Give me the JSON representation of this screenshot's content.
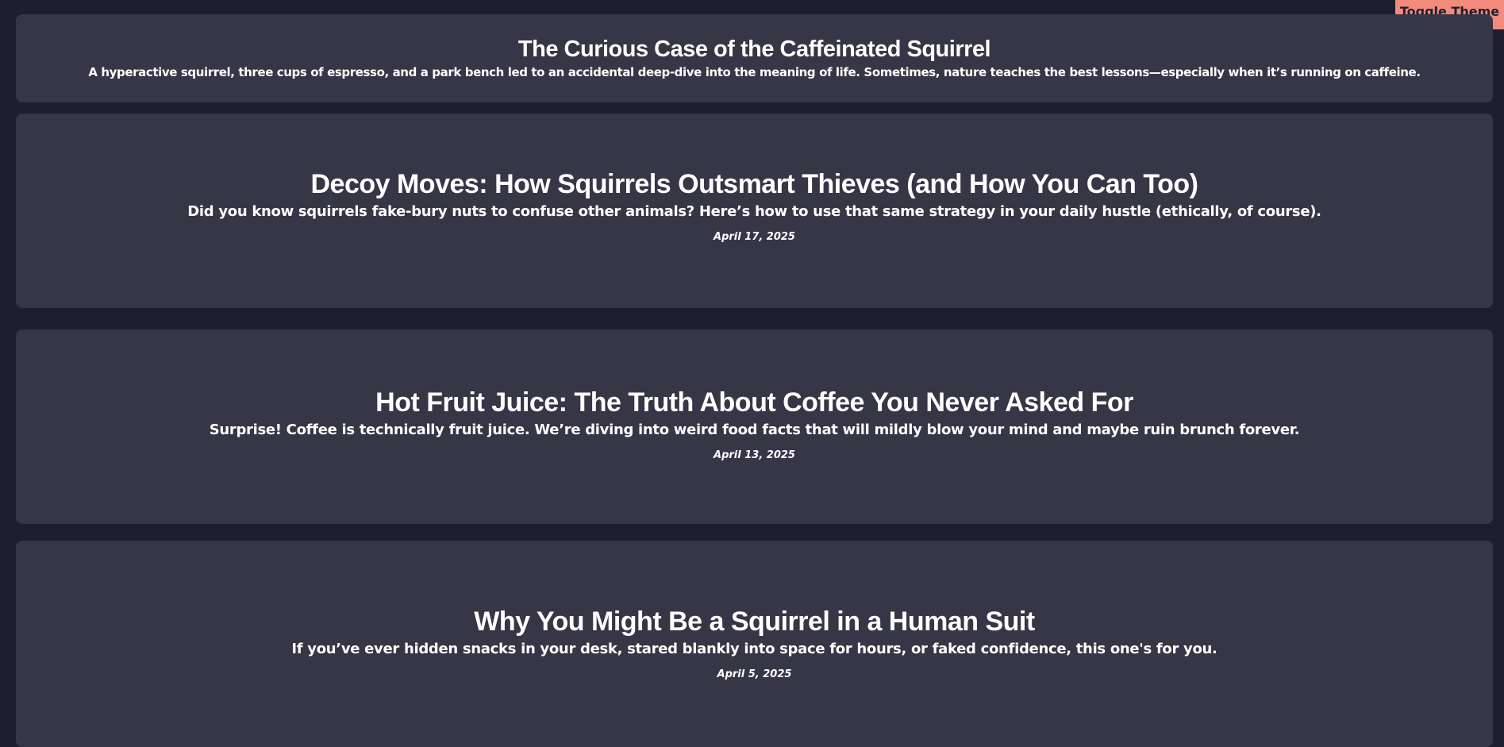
{
  "header": {
    "toggle_theme_label": "Toggle Theme"
  },
  "posts": [
    {
      "title": "The Curious Case of the Caffeinated Squirrel",
      "summary": "A hyperactive squirrel, three cups of espresso, and a park bench led to an accidental deep-dive into the meaning of life. Sometimes, nature teaches the best lessons—especially when it’s running on caffeine."
    },
    {
      "title": "Decoy Moves: How Squirrels Outsmart Thieves (and How You Can Too)",
      "summary": "Did you know squirrels fake-bury nuts to confuse other animals? Here’s how to use that same strategy in your daily hustle (ethically, of course).",
      "date": "April 17, 2025"
    },
    {
      "title": "Hot Fruit Juice: The Truth About Coffee You Never Asked For",
      "summary": "Surprise! Coffee is technically fruit juice. We’re diving into weird food facts that will mildly blow your mind and maybe ruin brunch forever.",
      "date": "April 13, 2025"
    },
    {
      "title": "Why You Might Be a Squirrel in a Human Suit",
      "summary": "If you’ve ever hidden snacks in your desk, stared blankly into space for hours, or faked confidence, this one's for you.",
      "date": "April 5, 2025"
    }
  ],
  "colors": {
    "background": "#1e1e2e",
    "card": "#363646",
    "accent": "#f38b7c",
    "text": "#ffffff"
  }
}
